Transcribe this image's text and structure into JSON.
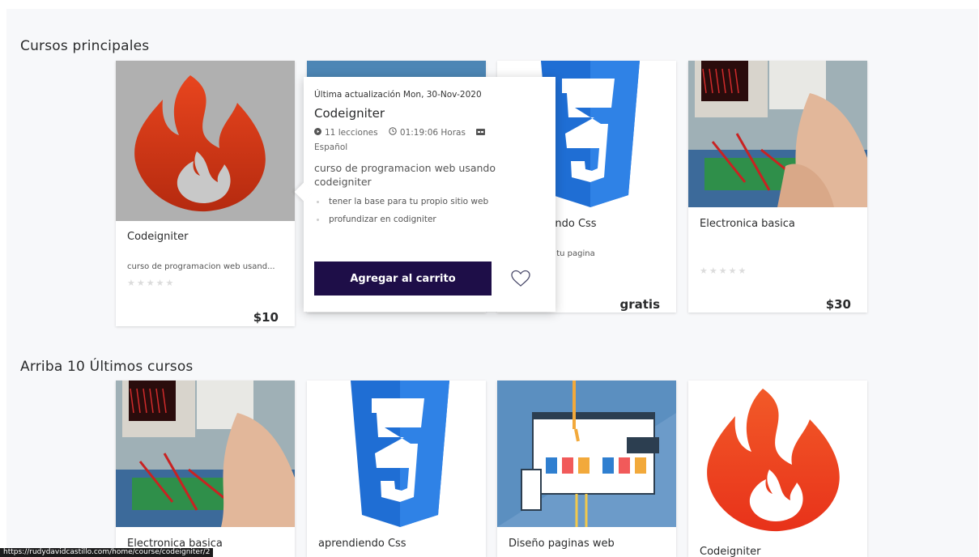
{
  "sections": {
    "top_courses": "Cursos principales",
    "latest_courses": "Arriba 10 Últimos cursos"
  },
  "top_cards": [
    {
      "title": "Codeigniter",
      "subtitle": "curso de programacion web usand...",
      "price": "$10"
    },
    {
      "title": "aprendiendo Css",
      "subtitle": "dar estilo a tu pagina",
      "price": "gratis"
    },
    {
      "title": "Electronica basica",
      "subtitle": "",
      "price": "$30"
    }
  ],
  "popup": {
    "updated": "Última actualización Mon, 30-Nov-2020",
    "title": "Codeigniter",
    "lessons": "11 lecciones",
    "duration": "01:19:06 Horas",
    "language": "Español",
    "description": "curso de programacion web usando codeigniter",
    "outcomes": [
      "tener la base para tu propio sitio web",
      "profundizar en codigniter"
    ],
    "cart_button": "Agregar al carrito"
  },
  "latest_cards": [
    {
      "title": "Electronica basica"
    },
    {
      "title": "aprendiendo Css"
    },
    {
      "title": "Diseño paginas web"
    },
    {
      "title": "Codeigniter"
    }
  ],
  "status_url": "https://rudydavidcastillo.com/home/course/codeigniter/2",
  "colors": {
    "cart_button": "#1e0e48",
    "css_blue": "#1f6ed4",
    "flame": "#dd3b1c"
  }
}
